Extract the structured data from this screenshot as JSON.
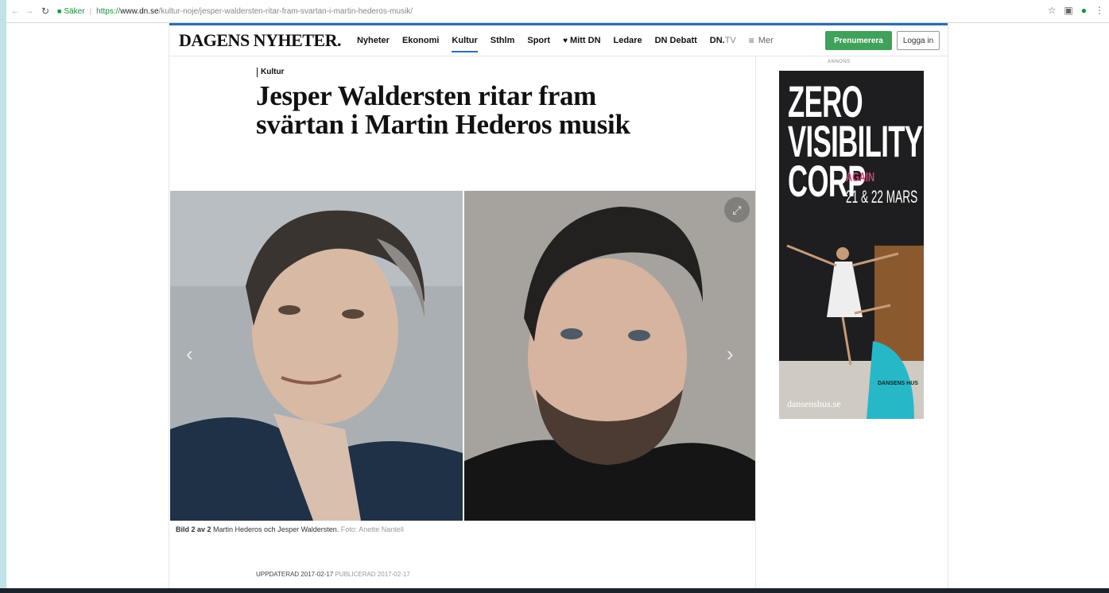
{
  "browser": {
    "secure_label": "Säker",
    "url_scheme": "https://",
    "url_host": "www.dn.se",
    "url_path": "/kultur-noje/jesper-waldersten-ritar-fram-svartan-i-martin-hederos-musik/"
  },
  "header": {
    "logo": "DAGENS NYHETER.",
    "nav": [
      {
        "label": "Nyheter"
      },
      {
        "label": "Ekonomi"
      },
      {
        "label": "Kultur",
        "active": true
      },
      {
        "label": "Sthlm"
      },
      {
        "label": "Sport"
      },
      {
        "label": "Mitt DN",
        "icon": "heart-icon"
      },
      {
        "label": "Ledare"
      },
      {
        "label": "DN Debatt"
      },
      {
        "label_main": "DN.",
        "label_suffix": "TV"
      },
      {
        "label": "Mer",
        "icon": "hamburger-icon"
      }
    ],
    "subscribe_label": "Prenumerera",
    "login_label": "Logga in"
  },
  "article": {
    "kicker": "Kultur",
    "headline": "Jesper Waldersten ritar fram svärtan i Martin Hederos musik",
    "caption": {
      "counter": "Bild 2 av 2",
      "text": " Martin Hederos och Jesper Waldersten.",
      "credit": " Foto: Anette Nantell"
    },
    "updated": "UPPDATERAD 2017-02-17",
    "published": " PUBLICERAD 2017-02-17"
  },
  "ad": {
    "label": "ANNONS",
    "title_lines": [
      "ZERO",
      "VISIBILITY",
      "CORP"
    ],
    "again": "AGAIN",
    "dates": "21 & 22 MARS",
    "url": "dansenshus.se",
    "badge": "DANSENS HUS"
  },
  "colors": {
    "accent": "#2d6ea8",
    "subscribe": "#3fa15a",
    "ad_background": "#1e1e20",
    "ad_highlight": "#d2407a",
    "ad_badge": "#27b8c8"
  }
}
